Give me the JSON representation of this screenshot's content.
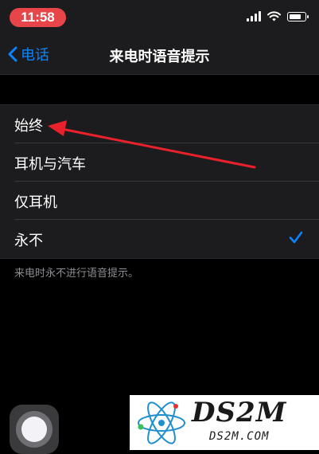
{
  "status_bar": {
    "time": "11:58"
  },
  "nav": {
    "back_label": "电话",
    "title": "来电时语音提示"
  },
  "options": [
    {
      "label": "始终",
      "selected": false
    },
    {
      "label": "耳机与汽车",
      "selected": false
    },
    {
      "label": "仅耳机",
      "selected": false
    },
    {
      "label": "永不",
      "selected": true
    }
  ],
  "footnote": "来电时永不进行语音提示。",
  "watermark": {
    "title": "DS2M",
    "subtitle": "DS2M.COM"
  },
  "colors": {
    "accent": "#0a84ff",
    "annotation_arrow": "#e8212a",
    "time_pill": "#e8454a"
  }
}
